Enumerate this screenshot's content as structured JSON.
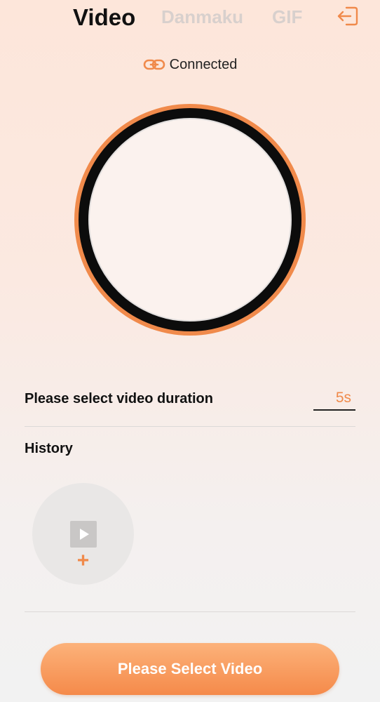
{
  "tabs": [
    {
      "label": "Video",
      "active": true
    },
    {
      "label": "Danmaku",
      "active": false
    },
    {
      "label": "GIF",
      "active": false
    }
  ],
  "header": {
    "exit_icon": "exit-icon"
  },
  "status": {
    "icon": "link-icon",
    "text": "Connected"
  },
  "duration": {
    "label": "Please select video duration",
    "value": "5s"
  },
  "history": {
    "title": "History",
    "add_icon": "play-icon",
    "plus": "+"
  },
  "action": {
    "label": "Please Select Video"
  },
  "colors": {
    "accent": "#f08a4b",
    "text": "#111111",
    "inactive_tab": "#d8d0cd"
  }
}
